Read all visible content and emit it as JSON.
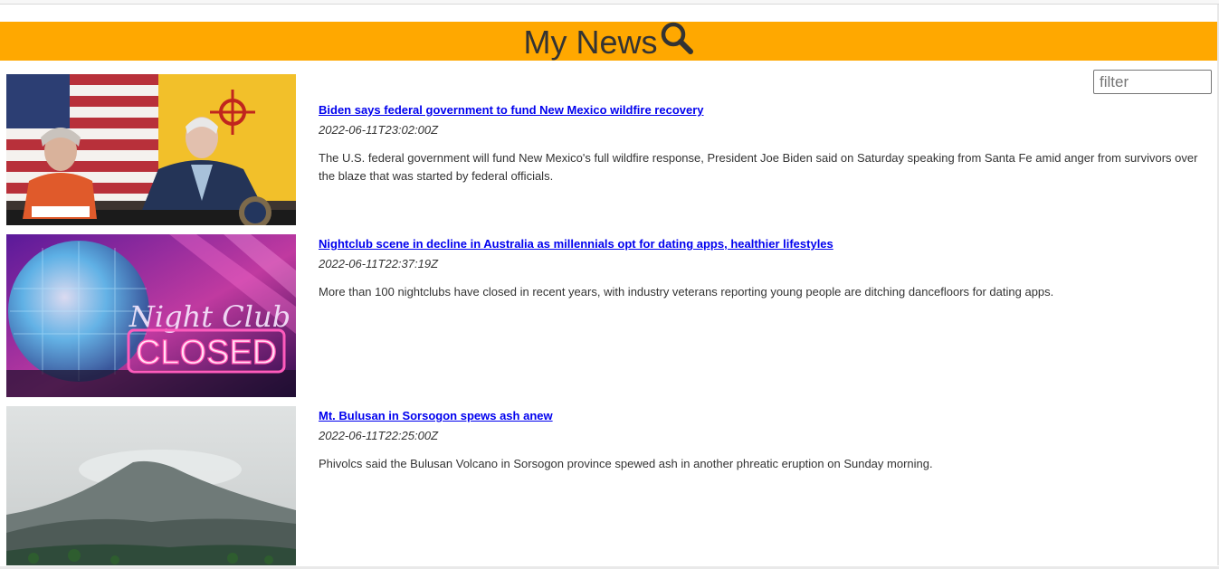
{
  "app": {
    "title": "My News",
    "header_bg": "#ffa800",
    "header_text_color": "#333333",
    "search_icon": "search-icon"
  },
  "filter": {
    "placeholder": "filter",
    "value": ""
  },
  "articles": [
    {
      "title": "Biden says federal government to fund New Mexico wildfire recovery",
      "date": "2022-06-11T23:02:00Z",
      "summary": "The U.S. federal government will fund New Mexico's full wildfire response, President Joe Biden said on Saturday speaking from Santa Fe amid anger from survivors over the blaze that was started by federal officials.",
      "image": "news-photo"
    },
    {
      "title": "Nightclub scene in decline in Australia as millennials opt for dating apps, healthier lifestyles",
      "date": "2022-06-11T22:37:19Z",
      "summary": "More than 100 nightclubs have closed in recent years, with industry veterans reporting young people are ditching dancefloors for dating apps.",
      "image": "news-photo",
      "image_text": {
        "line1": "Night Club",
        "line2": "CLOSED"
      }
    },
    {
      "title": "Mt. Bulusan in Sorsogon spews ash anew",
      "date": "2022-06-11T22:25:00Z",
      "summary": "Phivolcs said the Bulusan Volcano in Sorsogon province spewed ash in another phreatic eruption on Sunday morning.",
      "image": "news-photo"
    }
  ]
}
